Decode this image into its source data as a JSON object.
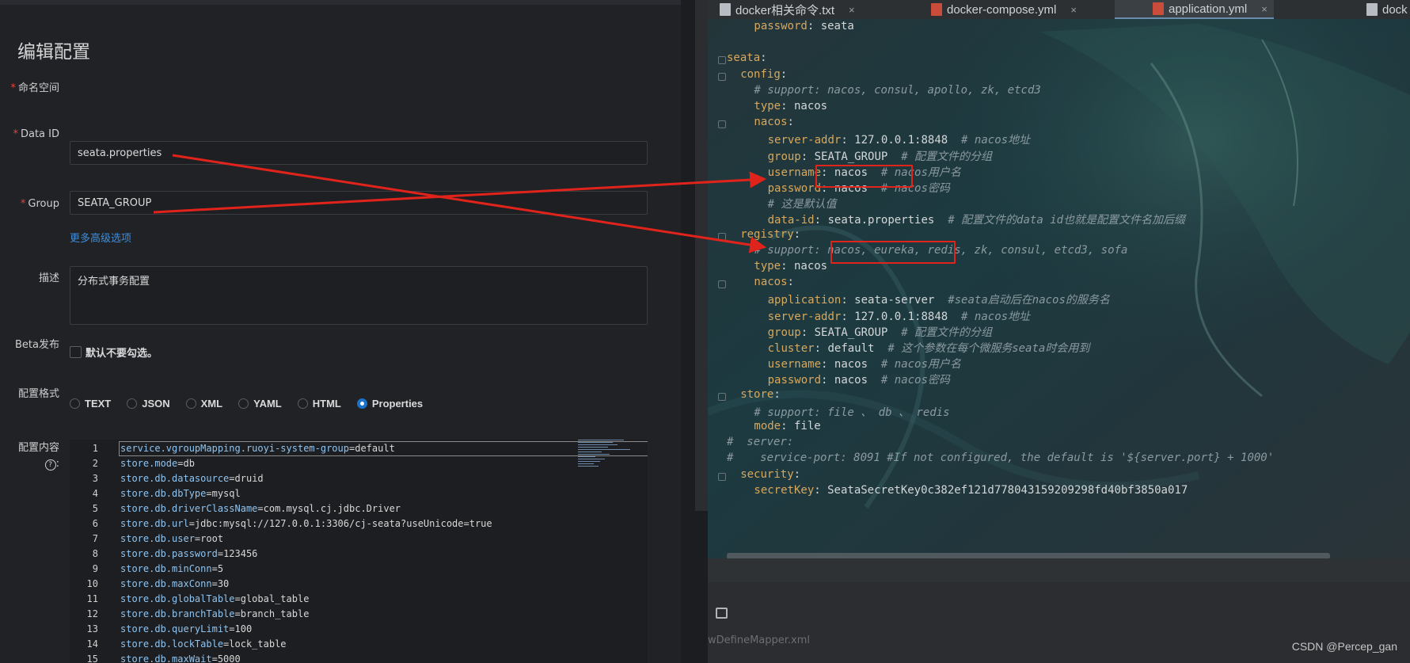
{
  "form": {
    "title": "编辑配置",
    "fields": {
      "namespace_label": "命名空间",
      "dataid_label": "Data ID",
      "dataid_value": "seata.properties",
      "group_label": "Group",
      "group_value": "SEATA_GROUP",
      "advanced_link": "更多高级选项",
      "desc_label": "描述",
      "desc_value": "分布式事务配置",
      "beta_label": "Beta发布",
      "beta_hint": "默认不要勾选。",
      "format_label": "配置格式",
      "content_label": "配置内容",
      "help_glyph": "?",
      "content_suffix": ":",
      "required_mark": "*"
    },
    "formats": [
      {
        "label": "TEXT",
        "selected": false
      },
      {
        "label": "JSON",
        "selected": false
      },
      {
        "label": "XML",
        "selected": false
      },
      {
        "label": "YAML",
        "selected": false
      },
      {
        "label": "HTML",
        "selected": false
      },
      {
        "label": "Properties",
        "selected": true
      }
    ],
    "editor_lines": [
      {
        "n": "1",
        "key": "service.vgroupMapping.ruoyi-system-group",
        "val": "default"
      },
      {
        "n": "2",
        "key": "store.mode",
        "val": "db"
      },
      {
        "n": "3",
        "key": "store.db.datasource",
        "val": "druid"
      },
      {
        "n": "4",
        "key": "store.db.dbType",
        "val": "mysql"
      },
      {
        "n": "5",
        "key": "store.db.driverClassName",
        "val": "com.mysql.cj.jdbc.Driver"
      },
      {
        "n": "6",
        "key": "store.db.url",
        "val": "jdbc:mysql://127.0.0.1:3306/cj-seata?useUnicode=true"
      },
      {
        "n": "7",
        "key": "store.db.user",
        "val": "root"
      },
      {
        "n": "8",
        "key": "store.db.password",
        "val": "123456"
      },
      {
        "n": "9",
        "key": "store.db.minConn",
        "val": "5"
      },
      {
        "n": "10",
        "key": "store.db.maxConn",
        "val": "30"
      },
      {
        "n": "11",
        "key": "store.db.globalTable",
        "val": "global_table"
      },
      {
        "n": "12",
        "key": "store.db.branchTable",
        "val": "branch_table"
      },
      {
        "n": "13",
        "key": "store.db.queryLimit",
        "val": "100"
      },
      {
        "n": "14",
        "key": "store.db.lockTable",
        "val": "lock_table"
      },
      {
        "n": "15",
        "key": "store.db.maxWait",
        "val": "5000"
      }
    ]
  },
  "ide": {
    "tabs": [
      {
        "label": "docker相关命令.txt",
        "type": "txt",
        "active": false
      },
      {
        "label": "docker-compose.yml",
        "type": "yml",
        "active": false
      },
      {
        "label": "application.yml",
        "type": "yml",
        "active": true
      },
      {
        "label": "dock",
        "type": "txt",
        "active": false
      }
    ],
    "close_glyph": "×",
    "yaml_lines": [
      {
        "i": 4,
        "k": "password",
        "v": "seata",
        "c": ""
      },
      {
        "i": 0,
        "k": "",
        "v": "",
        "c": ""
      },
      {
        "i": 0,
        "k": "seata",
        "v": "",
        "c": ""
      },
      {
        "i": 2,
        "k": "config",
        "v": "",
        "c": ""
      },
      {
        "i": 4,
        "k": "",
        "v": "",
        "c": "# support: nacos, consul, apollo, zk, etcd3"
      },
      {
        "i": 4,
        "k": "type",
        "v": "nacos",
        "c": ""
      },
      {
        "i": 4,
        "k": "nacos",
        "v": "",
        "c": ""
      },
      {
        "i": 6,
        "k": "server-addr",
        "v": "127.0.0.1:8848",
        "c": "# nacos地址"
      },
      {
        "i": 6,
        "k": "group",
        "v": "SEATA_GROUP",
        "c": "# 配置文件的分组"
      },
      {
        "i": 6,
        "k": "username",
        "v": "nacos",
        "c": "# nacos用户名"
      },
      {
        "i": 6,
        "k": "password",
        "v": "nacos",
        "c": "# nacos密码"
      },
      {
        "i": 6,
        "k": "",
        "v": "",
        "c": "# 这是默认值"
      },
      {
        "i": 6,
        "k": "data-id",
        "v": "seata.properties",
        "c": "# 配置文件的data id也就是配置文件名加后缀"
      },
      {
        "i": 2,
        "k": "registry",
        "v": "",
        "c": ""
      },
      {
        "i": 4,
        "k": "",
        "v": "",
        "c": "# support: nacos, eureka, redis, zk, consul, etcd3, sofa"
      },
      {
        "i": 4,
        "k": "type",
        "v": "nacos",
        "c": ""
      },
      {
        "i": 4,
        "k": "nacos",
        "v": "",
        "c": ""
      },
      {
        "i": 6,
        "k": "application",
        "v": "seata-server",
        "c": "#seata启动后在nacos的服务名"
      },
      {
        "i": 6,
        "k": "server-addr",
        "v": "127.0.0.1:8848",
        "c": "# nacos地址"
      },
      {
        "i": 6,
        "k": "group",
        "v": "SEATA_GROUP",
        "c": "# 配置文件的分组"
      },
      {
        "i": 6,
        "k": "cluster",
        "v": "default",
        "c": "# 这个参数在每个微服务seata时会用到"
      },
      {
        "i": 6,
        "k": "username",
        "v": "nacos",
        "c": "# nacos用户名"
      },
      {
        "i": 6,
        "k": "password",
        "v": "nacos",
        "c": "# nacos密码"
      },
      {
        "i": 2,
        "k": "store",
        "v": "",
        "c": ""
      },
      {
        "i": 4,
        "k": "",
        "v": "",
        "c": "# support: file 、 db 、 redis"
      },
      {
        "i": 4,
        "k": "mode",
        "v": "file",
        "c": ""
      },
      {
        "i": 0,
        "k": "",
        "v": "",
        "c": "#  server:"
      },
      {
        "i": 0,
        "k": "",
        "v": "",
        "c": "#    service-port: 8091 #If not configured, the default is '${server.port} + 1000'"
      },
      {
        "i": 2,
        "k": "security",
        "v": "",
        "c": ""
      },
      {
        "i": 4,
        "k": "secretKey",
        "v": "SeataSecretKey0c382ef121d778043159209298fd40bf3850a017",
        "c": ""
      }
    ],
    "faded_file": "wDefineMapper.xml"
  },
  "watermark": "CSDN @Percep_gan",
  "colors": {
    "accent_blue": "#1a73c9",
    "link_blue": "#3f8ddb",
    "arrow_red": "#e0231b",
    "yaml_key": "#d8a85c"
  }
}
